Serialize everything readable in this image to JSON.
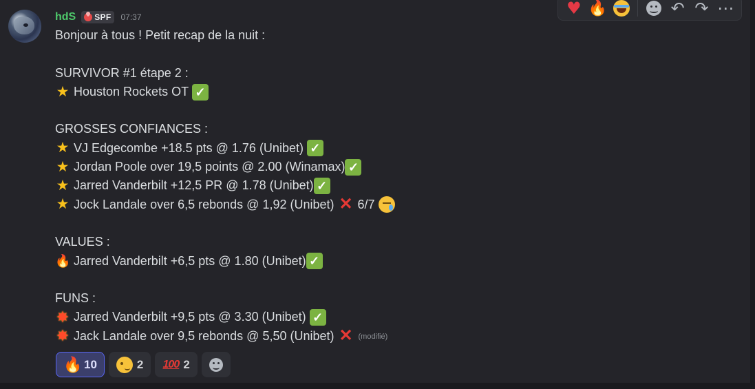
{
  "message": {
    "username": "hdS",
    "tag": "SPF",
    "timestamp": "07:37",
    "lines": [
      {
        "text": "Bonjour à tous ! Petit recap de la nuit :"
      },
      {
        "text": ""
      },
      {
        "text": "SURVIVOR #1 étape 2 :"
      },
      {
        "lead": "star-emoji",
        "text": "Houston Rockets OT",
        "trail": "check"
      },
      {
        "text": ""
      },
      {
        "text": "GROSSES CONFIANCES :"
      },
      {
        "lead": "star-emoji",
        "text": "VJ Edgecombe +18.5 pts @ 1.76 (Unibet)",
        "trail": "check"
      },
      {
        "lead": "star-emoji",
        "text": "Jordan Poole over 19,5 points @ 2.00 (Winamax)",
        "trail": "check",
        "tight": true
      },
      {
        "lead": "star-emoji",
        "text": "Jarred Vanderbilt +12,5 PR @ 1.78 (Unibet)",
        "trail": "check",
        "tight": true
      },
      {
        "lead": "star-emoji",
        "text": "Jock Landale over 6,5 rebonds @ 1,92 (Unibet)",
        "trail": "cross",
        "after": "6/7",
        "after_emoji": "tear"
      },
      {
        "text": ""
      },
      {
        "text": "VALUES :"
      },
      {
        "lead": "fire-emoji",
        "text": "Jarred Vanderbilt +6,5 pts @ 1.80 (Unibet)",
        "trail": "check",
        "tight": true
      },
      {
        "text": ""
      },
      {
        "text": "FUNS :"
      },
      {
        "lead": "collision-emoji",
        "text": "Jarred Vanderbilt +9,5 pts @ 3.30 (Unibet)",
        "trail": "check"
      },
      {
        "lead": "collision-emoji",
        "text": "Jack Landale over 9,5 rebonds @ 5,50 (Unibet)",
        "trail": "cross",
        "edited": "(modifié)"
      }
    ]
  },
  "reactions": [
    {
      "icon": "fire-emoji",
      "count": "10",
      "active": true
    },
    {
      "icon": "wink-emoji",
      "count": "2",
      "active": false
    },
    {
      "icon": "hundred-emoji",
      "count": "2",
      "active": false
    }
  ],
  "toolbar": {
    "quick_reactions": [
      "heart-emoji",
      "fire-emoji",
      "joy-emoji"
    ],
    "actions": [
      "add-reaction-icon",
      "reply-icon",
      "forward-icon",
      "more-icon"
    ]
  },
  "colors": {
    "username": "#4ec96b",
    "background": "#242429",
    "active_reaction_border": "#5865f2",
    "check_green": "#7cb342",
    "cross_red": "#e53935"
  }
}
